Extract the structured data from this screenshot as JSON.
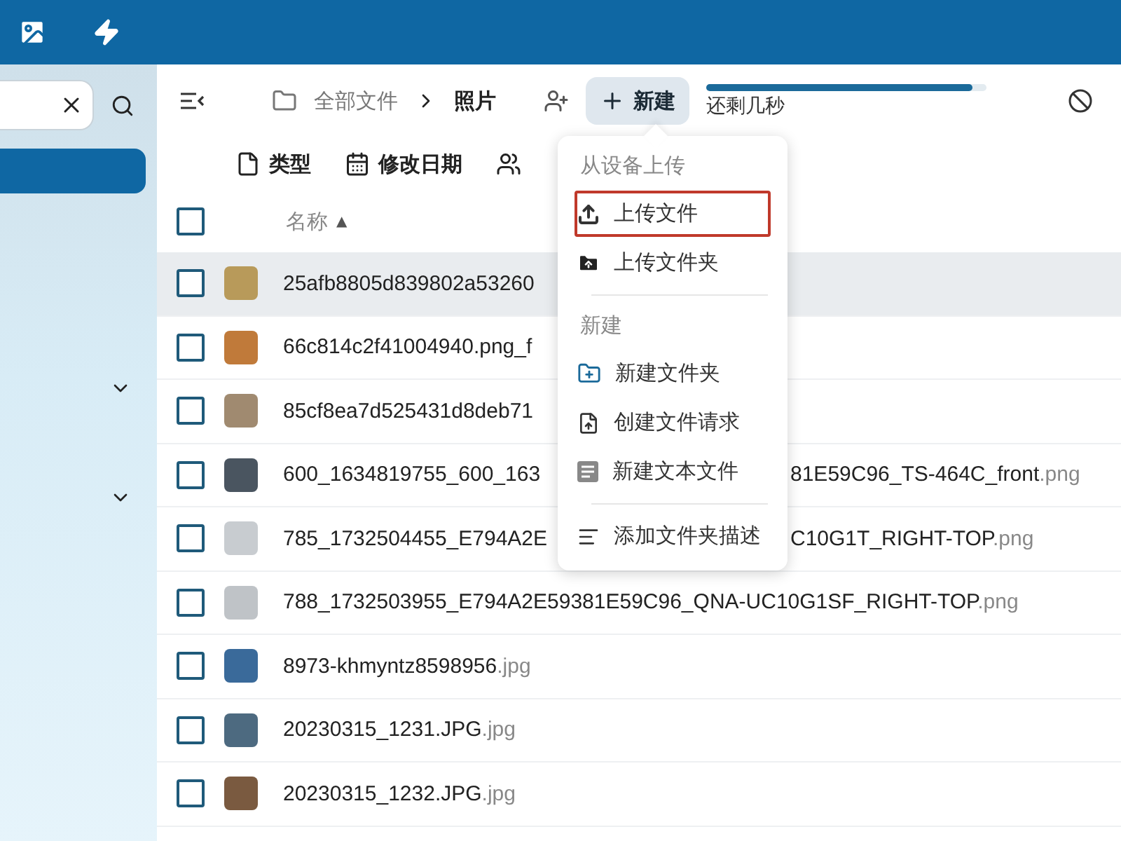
{
  "sidebar": {
    "nav_items": [
      {
        "selected": true
      },
      {
        "selected": false,
        "expanded": false
      },
      {
        "selected": false,
        "expanded": false
      }
    ]
  },
  "toolbar": {
    "breadcrumb": [
      "全部文件",
      "照片"
    ],
    "new_button": "新建",
    "upload": {
      "level": 0.95,
      "status": "还剩几秒"
    }
  },
  "filters": [
    {
      "kind": "type",
      "label": "类型"
    },
    {
      "kind": "date",
      "label": "修改日期"
    },
    {
      "kind": "people"
    }
  ],
  "table": {
    "header": {
      "checked": false,
      "label": "名称",
      "sort": "▲"
    },
    "rows": [
      {
        "checked": false,
        "highlighted": true,
        "name": "25afb8805d839802a53260"
      },
      {
        "checked": false,
        "highlighted": false,
        "name": "66c814c2f41004940.png_f"
      },
      {
        "checked": false,
        "highlighted": false,
        "name": "85cf8ea7d525431d8deb71"
      },
      {
        "checked": false,
        "highlighted": false,
        "name": "600_1634819755_600_163",
        "tail": "81E59C96_TS-464C_front",
        "ext": ".png"
      },
      {
        "checked": false,
        "highlighted": false,
        "name": "785_1732504455_E794A2E",
        "tail": "C10G1T_RIGHT-TOP",
        "ext": ".png"
      },
      {
        "checked": false,
        "highlighted": false,
        "name": "788_1732503955_E794A2E59381E59C96_QNA-UC10G1SF_RIGHT-TOP",
        "ext": ".png"
      },
      {
        "checked": false,
        "highlighted": false,
        "name": "8973-khmyntz8598956",
        "ext": ".jpg"
      },
      {
        "checked": false,
        "highlighted": false,
        "name": "20230315_1231.JPG",
        "ext": ".jpg"
      },
      {
        "checked": false,
        "highlighted": false,
        "name": "20230315_1232.JPG",
        "ext": ".jpg"
      }
    ]
  },
  "menu": [
    {
      "kind": "section",
      "label": "从设备上传"
    },
    {
      "kind": "upload",
      "label": "上传文件",
      "highlighted": true
    },
    {
      "kind": "uploadfolder",
      "label": "上传文件夹",
      "highlighted": false
    },
    {
      "kind": "divider"
    },
    {
      "kind": "section",
      "label": "新建"
    },
    {
      "kind": "newfolder",
      "label": "新建文件夹",
      "highlighted": false
    },
    {
      "kind": "request",
      "label": "创建文件请求",
      "highlighted": false
    },
    {
      "kind": "textfile",
      "label": "新建文本文件",
      "highlighted": false
    },
    {
      "kind": "divider"
    },
    {
      "kind": "describe",
      "label": "添加文件夹描述",
      "highlighted": false
    }
  ]
}
